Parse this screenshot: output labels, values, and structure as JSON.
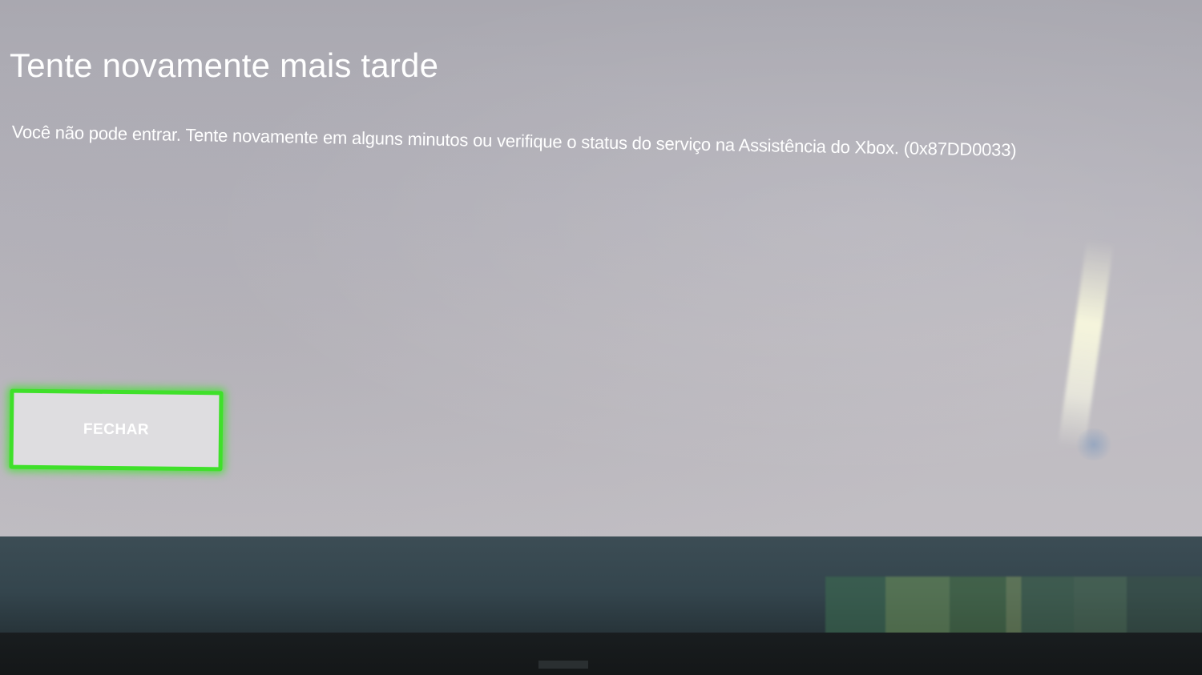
{
  "dialog": {
    "title": "Tente novamente mais tarde",
    "message": "Você não pode entrar. Tente novamente em alguns minutos ou verifique o status do serviço na Assistência do Xbox. (0x87DD0033)",
    "close_label": "FECHAR"
  },
  "colors": {
    "focus_ring": "#3fe02a",
    "screen_background": "#b8b6bd",
    "button_background": "#dedde0",
    "text": "#ffffff"
  }
}
